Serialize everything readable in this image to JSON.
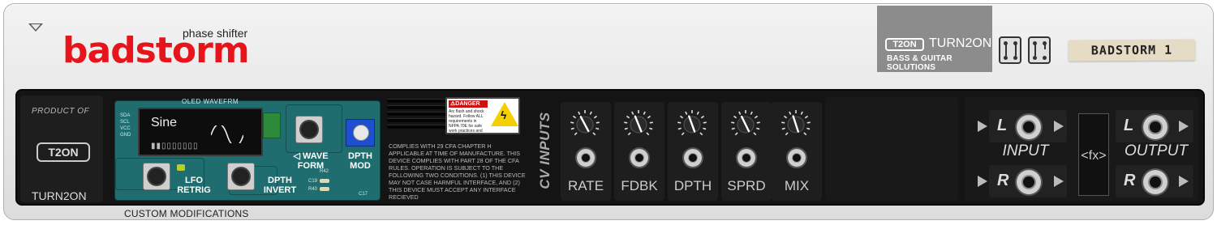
{
  "device": {
    "sub_label": "phase shifter",
    "brand": "badstorm",
    "custom": "CUSTOM MODIFICATIONS",
    "patch_name": "BADSTORM 1"
  },
  "maker": {
    "logo": "T2ON",
    "name": "TURN2ON",
    "tagline": "BASS & GUITAR SOLUTIONS",
    "product_of": "PRODUCT OF"
  },
  "oled": {
    "label": "OLED WAVEFRM",
    "wave": "Sine",
    "bars": "▮▮▯▯▯▯▯▯▯"
  },
  "pcb": {
    "wave_form": "◁ WAVE\nFORM",
    "depth_mod": "DPTH\nMOD",
    "lfo_retrig": "LFO\nRETRIG",
    "depth_invert": "DPTH\nINVERT",
    "pins": [
      "SDA",
      "SCL",
      "VCC",
      "GND"
    ],
    "c19": "C19",
    "r40": "R40",
    "r42": "R42",
    "c17": "C17"
  },
  "danger": {
    "title": "⚠DANGER",
    "text": "Arc flash and shock hazard. Follow ALL requirements in NFPA 70E for safe work practices and for Personal Protective Equipment."
  },
  "legal": "COMPLIES WITH 29 CFA CHAPTER H APPLICABLE AT TIME OF MANUFACTURE. THIS DEVICE COMPLIES WITH PART 28 OF THE CFA RULES. OPERATION IS SUBJECT TO THE FOLLOWING TWO CONDITIONS. (1) THIS DEVICE MAY NOT CASE HARMFUL INTERFACE, AND (2) THIS DEVICE MUST ACCEPT ANY INTERFACE RECIEVED",
  "cv": {
    "title": "CV INPUTS",
    "inputs": [
      {
        "label": "RATE",
        "angle": -28
      },
      {
        "label": "FDBK",
        "angle": -22
      },
      {
        "label": "DPTH",
        "angle": -20
      },
      {
        "label": "SPRD",
        "angle": -26
      },
      {
        "label": "MIX",
        "angle": -18
      }
    ]
  },
  "io": {
    "input": "INPUT",
    "output": "OUTPUT",
    "fx": "<fx>",
    "left": "L",
    "right": "R"
  },
  "colors": {
    "brand": "#e8141b",
    "panel": "#e6e6e6",
    "strip": "#141414",
    "pcb": "#1f6d6f"
  }
}
